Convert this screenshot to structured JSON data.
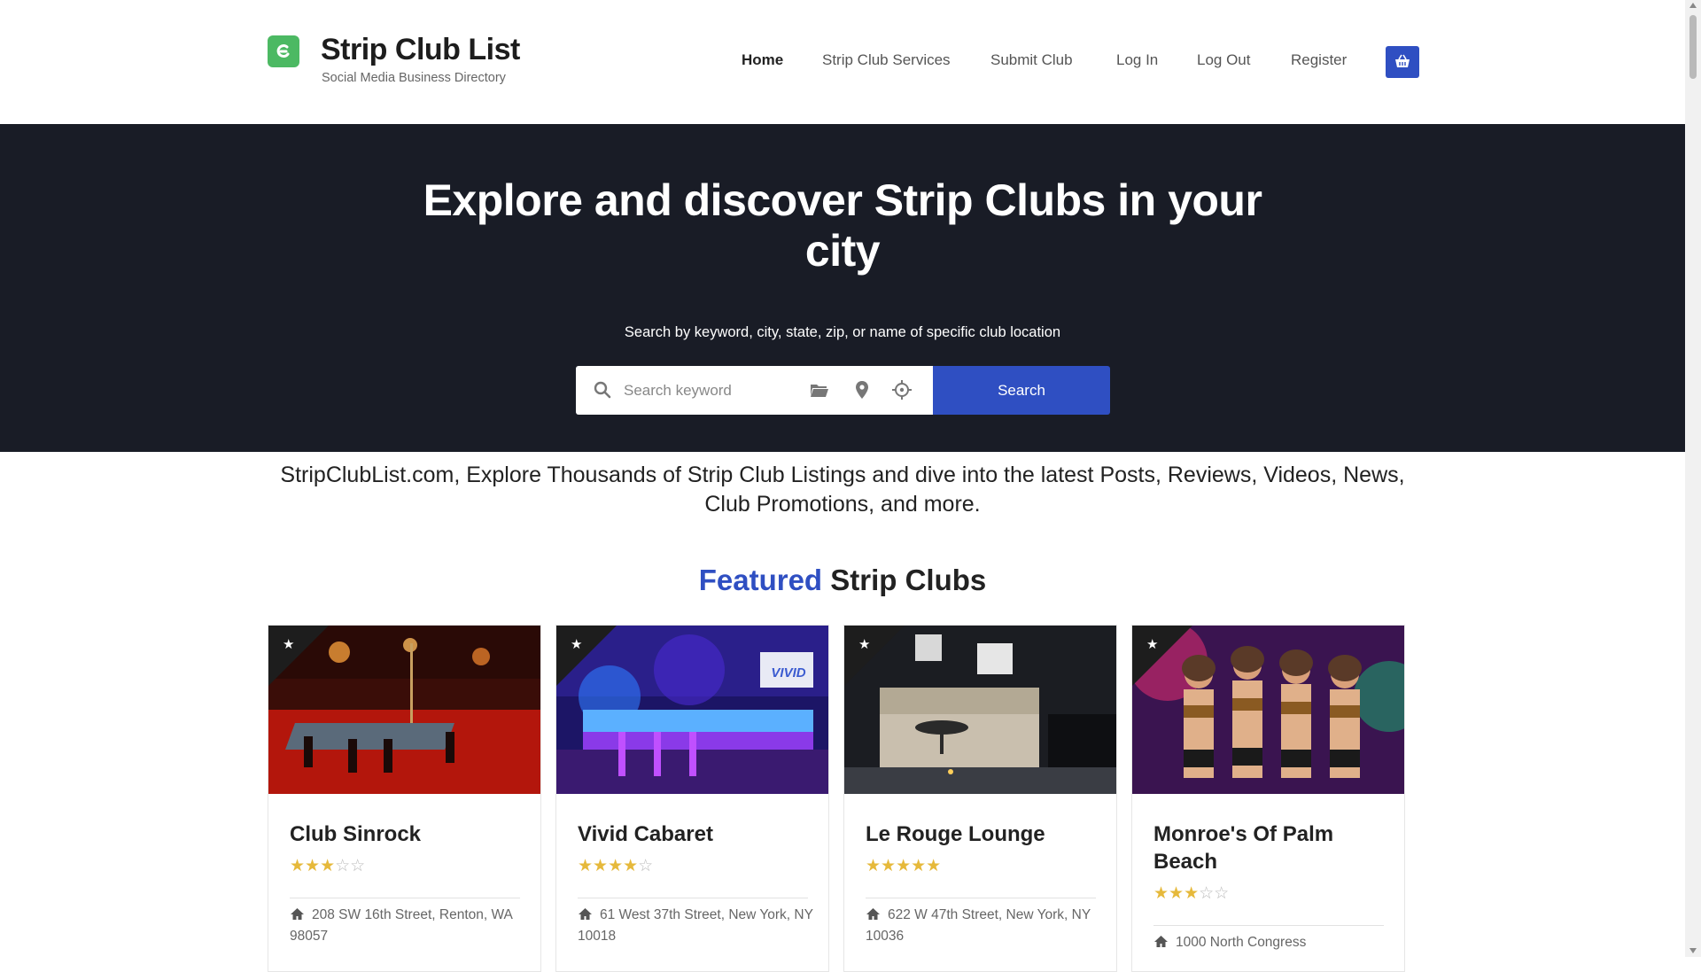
{
  "site": {
    "title": "Strip Club List",
    "tagline": "Social Media Business Directory",
    "brand_color": "#2f4fc2",
    "logo_color": "#4cb963"
  },
  "nav": {
    "items": [
      {
        "label": "Home",
        "active": true
      },
      {
        "label": "Strip Club Services",
        "active": false
      },
      {
        "label": "Submit Club",
        "active": false
      },
      {
        "label": "Log In",
        "active": false
      },
      {
        "label": "Log Out",
        "active": false
      },
      {
        "label": "Register",
        "active": false
      }
    ],
    "cart_icon": "basket-icon"
  },
  "hero": {
    "title": "Explore and discover Strip Clubs in your city",
    "subtitle": "Search by keyword, city, state, zip, or name of specific club location",
    "search_placeholder": "Search keyword",
    "search_button": "Search",
    "icons": [
      "search-icon",
      "folder-icon",
      "map-pin-icon",
      "crosshair-icon"
    ]
  },
  "intro": {
    "text": "StripClubList.com, Explore Thousands of Strip Club Listings and dive into the latest Posts, Reviews, Videos, News, Club Promotions, and more."
  },
  "featured": {
    "heading_accent": "Featured",
    "heading_rest": "Strip Clubs",
    "cards": [
      {
        "name": "Club Sinrock",
        "rating": 3,
        "max_rating": 5,
        "address": "208 SW 16th Street, Renton, WA 98057"
      },
      {
        "name": "Vivid Cabaret",
        "rating": 4,
        "max_rating": 5,
        "address": "61 West 37th Street, New York, NY 10018",
        "image_sign": "VIVID"
      },
      {
        "name": "Le Rouge Lounge",
        "rating": 5,
        "max_rating": 5,
        "address": "622 W 47th Street, New York, NY 10036"
      },
      {
        "name": "Monroe's Of Palm Beach",
        "rating": 3,
        "max_rating": 5,
        "address": "1000 North Congress"
      }
    ]
  }
}
